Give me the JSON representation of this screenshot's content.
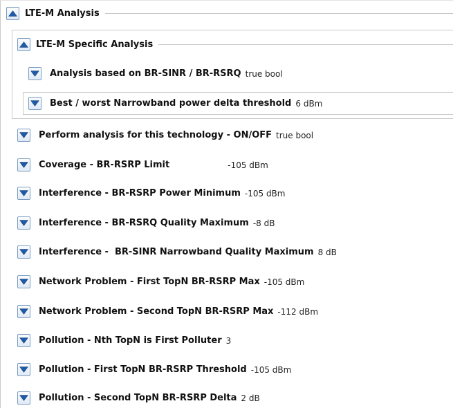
{
  "groups": {
    "outer": {
      "title": "LTE-M Analysis",
      "state": "expanded"
    },
    "specific": {
      "title": "LTE-M Specific Analysis",
      "state": "expanded"
    }
  },
  "specific_items": [
    {
      "label": "Analysis based on BR-SINR / BR-RSRQ",
      "value": "true bool"
    },
    {
      "label": "Best / worst Narrowband power delta threshold",
      "value": "6 dBm"
    }
  ],
  "items": [
    {
      "label": "Perform analysis for this technology - ON/OFF",
      "value": "true bool"
    },
    {
      "label": "Coverage - BR-RSRP Limit",
      "value": "-105 dBm"
    },
    {
      "label": "Interference - BR-RSRP Power Minimum",
      "value": "-105 dBm"
    },
    {
      "label": "Interference - BR-RSRQ Quality Maximum",
      "value": "-8 dB"
    },
    {
      "label": "Interference -  BR-SINR Narrowband Quality Maximum",
      "value": "8 dB"
    },
    {
      "label": "Network Problem - First TopN BR-RSRP Max",
      "value": "-105 dBm"
    },
    {
      "label": "Network Problem - Second TopN BR-RSRP Max",
      "value": "-112 dBm"
    },
    {
      "label": "Pollution - Nth TopN is First Polluter",
      "value": "3"
    },
    {
      "label": "Pollution - First TopN BR-RSRP Threshold",
      "value": "-105 dBm"
    },
    {
      "label": "Pollution - Second TopN BR-RSRP Delta",
      "value": "2 dB"
    }
  ],
  "icons": {
    "collapse": "chevron-up-icon",
    "expand": "chevron-down-icon"
  },
  "colors": {
    "icon_fill": "#1f5aa6",
    "button_border": "#7a9bc0",
    "rule": "#c8c8c8"
  }
}
